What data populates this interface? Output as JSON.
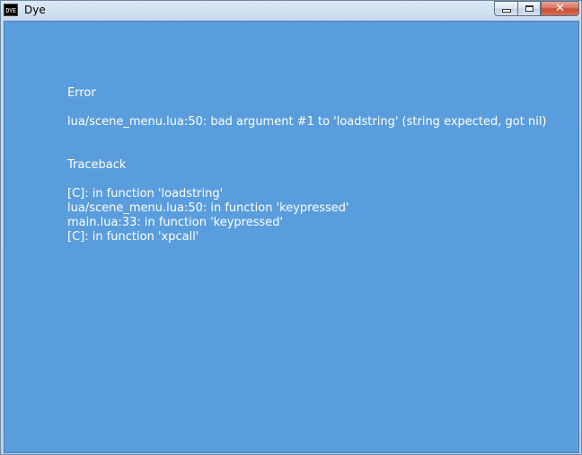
{
  "window": {
    "title": "Dye",
    "icon": "dye-app-icon",
    "icon_text": "DYE"
  },
  "controls": {
    "minimize": "minimize-icon",
    "maximize": "maximize-icon",
    "close_label": "✕"
  },
  "error_screen": {
    "heading": "Error",
    "message": "lua/scene_menu.lua:50: bad argument #1 to 'loadstring' (string expected, got nil)",
    "traceback_heading": "Traceback",
    "traceback": [
      "[C]: in function 'loadstring'",
      "lua/scene_menu.lua:50: in function 'keypressed'",
      "main.lua:33: in function 'keypressed'",
      "[C]: in function 'xpcall'"
    ],
    "background_color": "#5a9ddd",
    "text_color": "#ffffff"
  }
}
